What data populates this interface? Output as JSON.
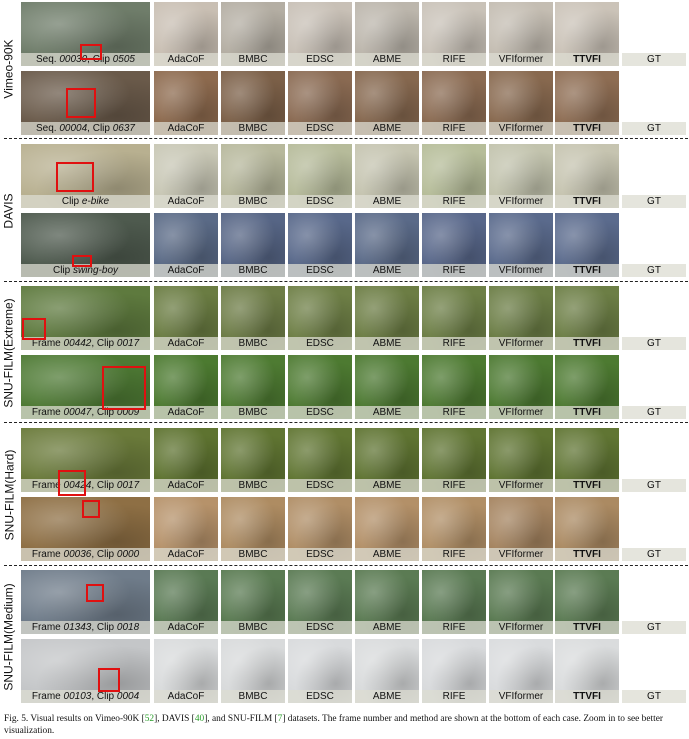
{
  "figure": {
    "methods": [
      "AdaCoF",
      "BMBC",
      "EDSC",
      "ABME",
      "RIFE",
      "VFIformer",
      "TTVFI",
      "GT"
    ],
    "bold_method": "TTVFI",
    "groups": [
      {
        "label": "Vimeo-90K"
      },
      {
        "label": "DAVIS"
      },
      {
        "label": "SNU-FILM(Extreme)"
      },
      {
        "label": "SNU-FILM(Hard)"
      },
      {
        "label": "SNU-FILM(Medium)"
      }
    ],
    "rows": [
      {
        "pre": "Seq. ",
        "a": "00030",
        "mid": ", Clip ",
        "b": "0505",
        "colors": [
          "#6f7d6a",
          "#c9bfb3",
          "#b4aea3",
          "#c8c0b6",
          "#bcb6ac",
          "#c9c2b8",
          "#c4bdb2",
          "#cbc3b8"
        ]
      },
      {
        "pre": "Seq. ",
        "a": "00004",
        "mid": ", Clip ",
        "b": "0637",
        "colors": [
          "#6a5a4a",
          "#8d6a4e",
          "#7c6048",
          "#8a6a52",
          "#86684f",
          "#8b6b52",
          "#88694f",
          "#8e6d53"
        ]
      },
      {
        "pre": "Clip ",
        "a": "e-bike",
        "mid": "",
        "b": "",
        "colors": [
          "#b8b090",
          "#c8c7b5",
          "#b7b89c",
          "#b6bb9a",
          "#c5c4b0",
          "#b6bd99",
          "#c2c3ad",
          "#c6c4b0"
        ]
      },
      {
        "pre": "Clip ",
        "a": "swing-boy",
        "mid": "",
        "b": "",
        "colors": [
          "#4e5a4e",
          "#5a6a86",
          "#566585",
          "#58688a",
          "#5a6a88",
          "#58678a",
          "#5a6a8c",
          "#5b6b8d"
        ]
      },
      {
        "pre": "Frame ",
        "a": "00442",
        "mid": ", Clip ",
        "b": "0017",
        "colors": [
          "#5e7a3e",
          "#6a7c42",
          "#6d7c46",
          "#6e7f46",
          "#6c7d44",
          "#6d7f46",
          "#6b7d45",
          "#6c7e45"
        ]
      },
      {
        "pre": "Frame ",
        "a": "00047",
        "mid": ", Clip ",
        "b": "0009",
        "colors": [
          "#4e7a34",
          "#4c7a30",
          "#4e7b32",
          "#4d7a31",
          "#4c7931",
          "#4d7a31",
          "#4c7931",
          "#4d7a31"
        ]
      },
      {
        "pre": "Frame ",
        "a": "00424",
        "mid": ", Clip ",
        "b": "0017",
        "colors": [
          "#6a7a3a",
          "#5e7330",
          "#607532",
          "#617633",
          "#5f7432",
          "#607533",
          "#5f7432",
          "#607533"
        ]
      },
      {
        "pre": "Frame ",
        "a": "00036",
        "mid": ", Clip ",
        "b": "0000",
        "colors": [
          "#8e6f44",
          "#b6926a",
          "#ae8c62",
          "#b08e66",
          "#b39068",
          "#b18f66",
          "#a58460",
          "#ab8a62"
        ]
      },
      {
        "pre": "Frame ",
        "a": "01343",
        "mid": ", Clip ",
        "b": "0018",
        "colors": [
          "#6f7c8a",
          "#5a7a54",
          "#5a7b52",
          "#5b7b54",
          "#5b7b53",
          "#5a7a53",
          "#5a7a52",
          "#5b7b53"
        ]
      },
      {
        "pre": "Frame ",
        "a": "00103",
        "mid": ", Clip ",
        "b": "0004",
        "colors": [
          "#c4c6c8",
          "#d9dbdc",
          "#d8dadb",
          "#d8dadc",
          "#d9dbdc",
          "#d8dadc",
          "#d9dbdd",
          "#dadcdd"
        ]
      }
    ]
  },
  "caption": {
    "p1": "Fig. 5.   Visual results on Vimeo-90K [",
    "r1": "52",
    "p2": "], DAVIS [",
    "r2": "40",
    "p3": "], and SNU-FILM [",
    "r3": "7",
    "p4": "] datasets. The frame number and method are shown at the bottom of each case. Zoom in to see better visualization."
  }
}
